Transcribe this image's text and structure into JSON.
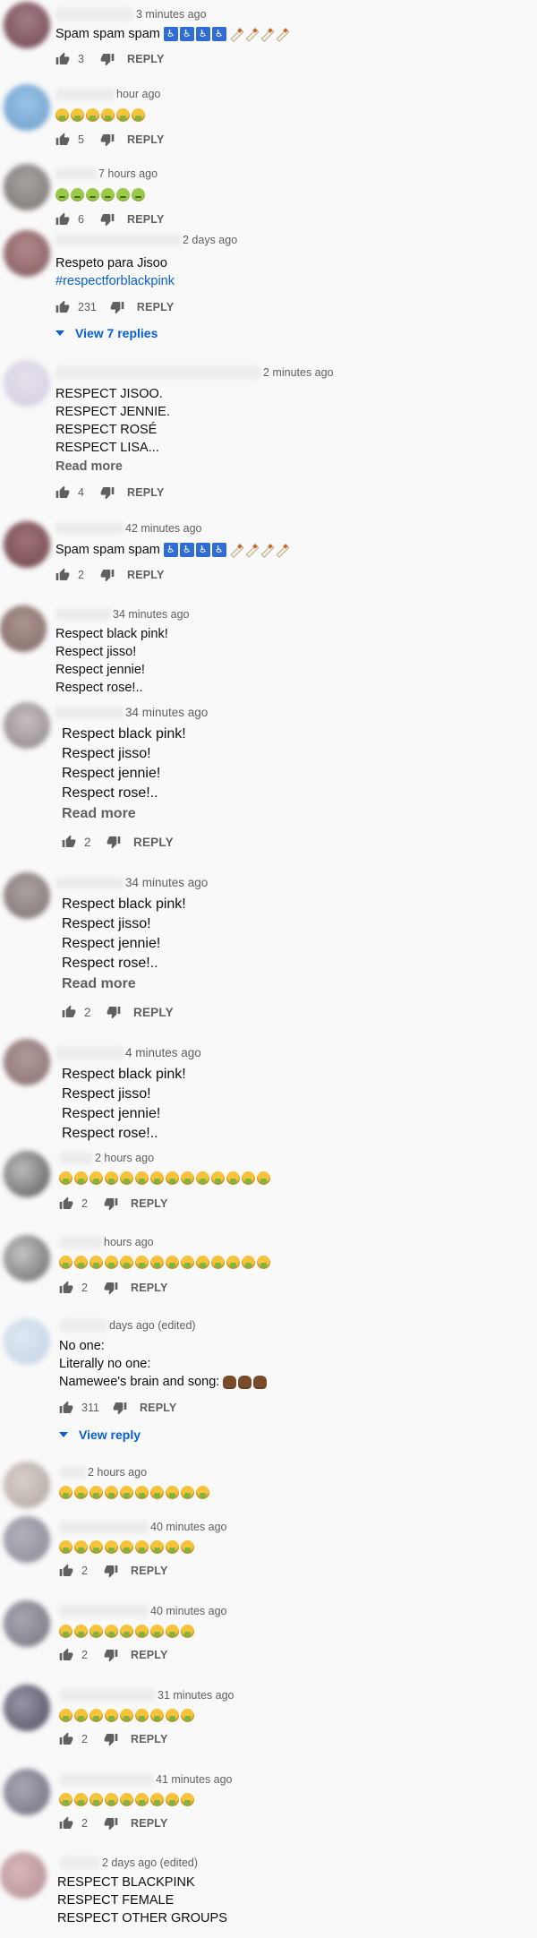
{
  "comments": [
    {
      "time": "3 minutes ago",
      "lines": [
        "Spam spam spam"
      ],
      "likes": "3",
      "reply": "REPLY"
    },
    {
      "time": "hour ago",
      "likes": "5",
      "reply": "REPLY"
    },
    {
      "time": "7 hours ago",
      "likes": "6",
      "reply": "REPLY"
    },
    {
      "time": "2 days ago",
      "lines": [
        "Respeto para Jisoo",
        "#respectforblackpink"
      ],
      "likes": "231",
      "reply": "REPLY",
      "view_replies": "View 7 replies"
    },
    {
      "time": "2 minutes ago",
      "lines": [
        "RESPECT JISOO.",
        "RESPECT JENNIE.",
        "RESPECT ROSÉ",
        "RESPECT LISA..."
      ],
      "read_more": "Read more",
      "likes": "4",
      "reply": "REPLY"
    },
    {
      "time": "42 minutes ago",
      "lines": [
        "Spam spam spam"
      ],
      "likes": "2",
      "reply": "REPLY"
    },
    {
      "time": "34 minutes ago",
      "lines": [
        "Respect black pink!",
        "Respect jisso!",
        "Respect jennie!",
        "Respect rose!.."
      ]
    },
    {
      "time": "34 minutes ago",
      "lines": [
        "Respect black pink!",
        "Respect jisso!",
        "Respect jennie!",
        "Respect rose!.."
      ],
      "read_more": "Read more",
      "likes": "2",
      "reply": "REPLY"
    },
    {
      "time": "34 minutes ago",
      "lines": [
        "Respect black pink!",
        "Respect jisso!",
        "Respect jennie!",
        "Respect rose!.."
      ],
      "read_more": "Read more",
      "likes": "2",
      "reply": "REPLY"
    },
    {
      "time": "4 minutes ago",
      "lines": [
        "Respect black pink!",
        "Respect jisso!",
        "Respect jennie!",
        "Respect rose!.."
      ]
    },
    {
      "time": "2 hours ago",
      "likes": "2",
      "reply": "REPLY"
    },
    {
      "time": "hours ago",
      "likes": "2",
      "reply": "REPLY"
    },
    {
      "time": "days ago (edited)",
      "lines": [
        "No one:",
        "Literally no one:",
        "Namewee's brain and song:"
      ],
      "likes": "311",
      "reply": "REPLY",
      "view_replies": "View reply"
    },
    {
      "time": "2 hours ago"
    },
    {
      "time": "40 minutes ago",
      "likes": "2",
      "reply": "REPLY"
    },
    {
      "time": "40 minutes ago",
      "likes": "2",
      "reply": "REPLY"
    },
    {
      "time": "31 minutes ago",
      "likes": "2",
      "reply": "REPLY"
    },
    {
      "time": "41 minutes ago",
      "likes": "2",
      "reply": "REPLY"
    },
    {
      "time": "2 days ago (edited)",
      "lines": [
        "RESPECT BLACKPINK",
        "RESPECT FEMALE",
        "RESPECT OTHER GROUPS"
      ]
    }
  ],
  "icons": {
    "like": "thumb-up-icon",
    "dislike": "thumb-down-icon",
    "expand": "caret-down-icon"
  },
  "colors": {
    "link": "#065fd4",
    "meta": "#606060",
    "text": "#0f0f0f",
    "background": "#f9f9f9"
  }
}
